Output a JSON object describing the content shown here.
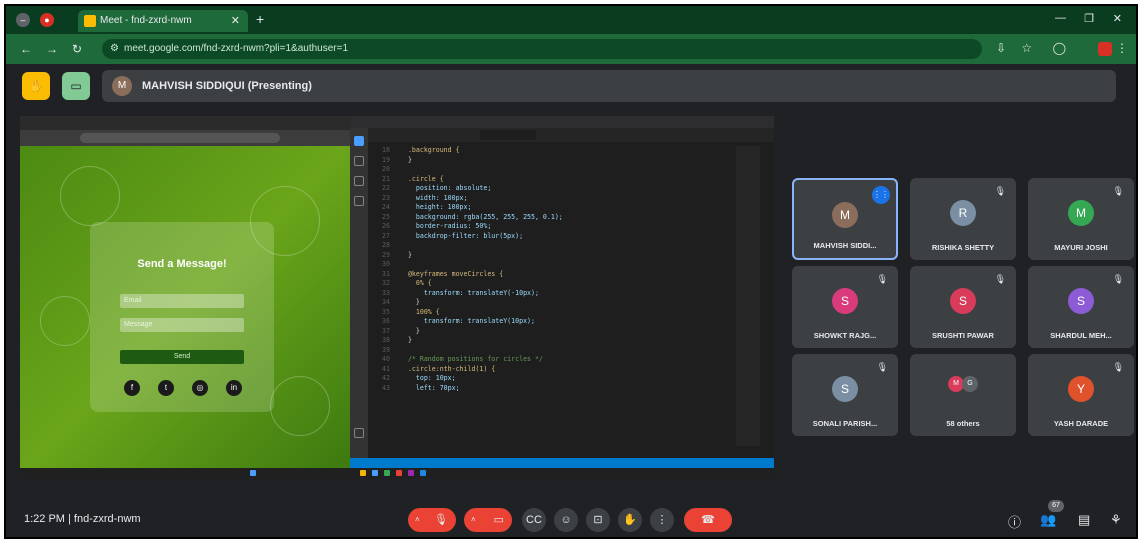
{
  "browser": {
    "tab_title": "Meet - fnd-zxrd-nwm",
    "url": "meet.google.com/fnd-zxrd-nwm?pli=1&authuser=1"
  },
  "meet": {
    "presenter_initial": "M",
    "presenter_label": "MAHVISH SIDDIQUI (Presenting)"
  },
  "shared_page": {
    "card_title": "Send a Message!",
    "email_placeholder": "Email",
    "message_placeholder": "Message",
    "send_label": "Send"
  },
  "code": {
    "lines": [
      {
        "n": "18",
        "t": "  .background {"
      },
      {
        "n": "19",
        "t": "  }"
      },
      {
        "n": "20",
        "t": ""
      },
      {
        "n": "21",
        "t": "  .circle {"
      },
      {
        "n": "22",
        "t": "    position: absolute;"
      },
      {
        "n": "23",
        "t": "    width: 100px;"
      },
      {
        "n": "24",
        "t": "    height: 100px;"
      },
      {
        "n": "25",
        "t": "    background: rgba(255, 255, 255, 0.1);"
      },
      {
        "n": "26",
        "t": "    border-radius: 50%;"
      },
      {
        "n": "27",
        "t": "    backdrop-filter: blur(5px);"
      },
      {
        "n": "28",
        "t": ""
      },
      {
        "n": "29",
        "t": "  }"
      },
      {
        "n": "30",
        "t": ""
      },
      {
        "n": "31",
        "t": "  @keyframes moveCircles {"
      },
      {
        "n": "32",
        "t": "    0% {"
      },
      {
        "n": "33",
        "t": "      transform: translateY(-10px);"
      },
      {
        "n": "34",
        "t": "    }"
      },
      {
        "n": "35",
        "t": "    100% {"
      },
      {
        "n": "36",
        "t": "      transform: translateY(10px);"
      },
      {
        "n": "37",
        "t": "    }"
      },
      {
        "n": "38",
        "t": "  }"
      },
      {
        "n": "39",
        "t": ""
      },
      {
        "n": "40",
        "t": "  /* Random positions for circles */"
      },
      {
        "n": "41",
        "t": "  .circle:nth-child(1) {"
      },
      {
        "n": "42",
        "t": "    top: 10px;"
      },
      {
        "n": "43",
        "t": "    left: 70px;"
      }
    ]
  },
  "participants": [
    {
      "initial": "M",
      "name": "MAHVISH SIDDI...",
      "color": "#8a6d5b",
      "speaking": true
    },
    {
      "initial": "R",
      "name": "RISHIKA SHETTY",
      "color": "#7a8fa3",
      "speaking": false
    },
    {
      "initial": "M",
      "name": "MAYURI JOSHI",
      "color": "#34a853",
      "speaking": false
    },
    {
      "initial": "S",
      "name": "SHOWKT RAJG...",
      "color": "#d93b7c",
      "speaking": false
    },
    {
      "initial": "S",
      "name": "SRUSHTI PAWAR",
      "color": "#d93b5a",
      "speaking": false
    },
    {
      "initial": "S",
      "name": "SHARDUL MEH...",
      "color": "#8e5bd6",
      "speaking": false
    },
    {
      "initial": "S",
      "name": "SONALI PARISH...",
      "color": "#7a8fa3",
      "speaking": false
    },
    {
      "initial": "",
      "name": "58 others",
      "color": "#5f6368",
      "speaking": false
    },
    {
      "initial": "Y",
      "name": "YASH DARADE",
      "color": "#e0522b",
      "speaking": false
    }
  ],
  "others_avatars": [
    "M",
    "G"
  ],
  "bottom": {
    "meeting_info": "1:22 PM  |  fnd-zxrd-nwm",
    "participants_badge": "67"
  },
  "colors": {
    "accent": "#8ab4f8",
    "end_call": "#ea4335"
  }
}
